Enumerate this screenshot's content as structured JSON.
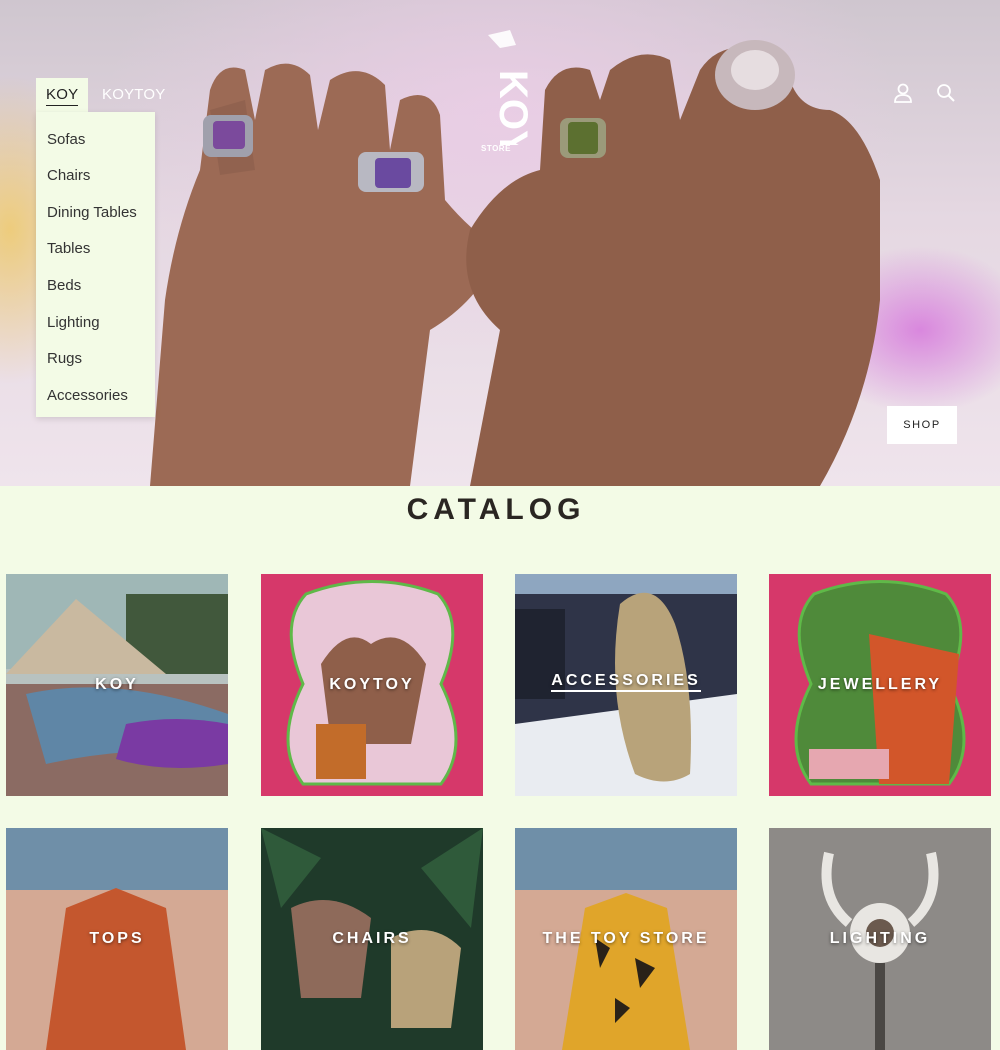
{
  "nav": {
    "items": [
      {
        "label": "KOY"
      },
      {
        "label": "KOYTOY"
      }
    ],
    "dropdown": [
      "Sofas",
      "Chairs",
      "Dining Tables",
      "Tables",
      "Beds",
      "Lighting",
      "Rugs",
      "Accessories"
    ]
  },
  "logo": {
    "text": "KOY",
    "subtext": "STORE"
  },
  "header_icons": [
    "account-icon",
    "search-icon"
  ],
  "hero": {
    "cta_label": "SHOP"
  },
  "catalog": {
    "title": "CATALOG",
    "tiles": [
      {
        "label": "KOY"
      },
      {
        "label": "KOYTOY"
      },
      {
        "label": "ACCESSORIES"
      },
      {
        "label": "JEWELLERY"
      },
      {
        "label": "TOPS"
      },
      {
        "label": "CHAIRS"
      },
      {
        "label": "THE TOY STORE"
      },
      {
        "label": "LIGHTING"
      }
    ]
  },
  "colors": {
    "background": "#f3fbe6",
    "accent_pink": "#d6386a",
    "text_dark": "#2a2622"
  }
}
